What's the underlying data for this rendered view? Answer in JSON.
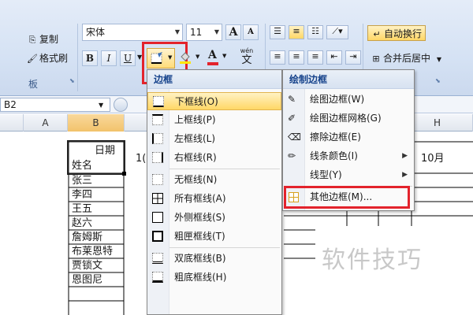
{
  "ribbon": {
    "copy_label": "复制",
    "format_painter_label": "格式刷",
    "clipboard_group": "板",
    "font_name": "宋体",
    "font_size": "11",
    "grow_font": "A",
    "shrink_font": "A",
    "bold": "B",
    "italic": "I",
    "underline": "U",
    "font_color_letter": "A",
    "phonetic_label": "wén",
    "phonetic_char": "文",
    "wrap_text_label": "自动换行",
    "merge_center_label": "合并后居中"
  },
  "name_box": "B2",
  "columns": [
    "A",
    "B",
    "H"
  ],
  "sheet": {
    "header_top": "日期",
    "header_bottom": "姓名",
    "partial_c2": "1(",
    "partial_h2": "10月",
    "names": [
      "张三",
      "李四",
      "王五",
      "赵六",
      "詹姆斯",
      "布莱恩特",
      "贾锁文",
      "恩图尼"
    ]
  },
  "border_menu": {
    "title": "边框",
    "items": [
      {
        "label": "下框线(O)"
      },
      {
        "label": "上框线(P)"
      },
      {
        "label": "左框线(L)"
      },
      {
        "label": "右框线(R)"
      },
      {
        "label": "无框线(N)"
      },
      {
        "label": "所有框线(A)"
      },
      {
        "label": "外侧框线(S)"
      },
      {
        "label": "粗匣框线(T)"
      },
      {
        "label": "双底框线(B)"
      },
      {
        "label": "粗底框线(H)"
      }
    ]
  },
  "draw_menu": {
    "title": "绘制边框",
    "items": [
      {
        "label": "绘图边框(W)"
      },
      {
        "label": "绘图边框网格(G)"
      },
      {
        "label": "擦除边框(E)"
      },
      {
        "label": "线条颜色(I)"
      },
      {
        "label": "线型(Y)"
      },
      {
        "label": "其他边框(M)..."
      }
    ]
  },
  "watermark": "软件技巧",
  "colors": {
    "highlight_border": "#e3232c",
    "menu_title": "#15428b",
    "hover": "#ffd766"
  }
}
